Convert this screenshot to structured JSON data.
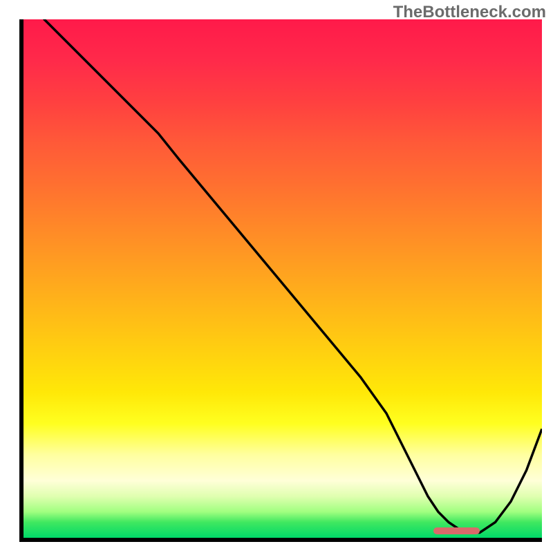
{
  "watermark": "TheBottleneck.com",
  "chart_data": {
    "type": "line",
    "title": "",
    "xlabel": "",
    "ylabel": "",
    "xlim": [
      0,
      100
    ],
    "ylim": [
      0,
      100
    ],
    "x": [
      0,
      4,
      22,
      26,
      30,
      35,
      40,
      45,
      50,
      55,
      60,
      65,
      70,
      72,
      74,
      76,
      78,
      80,
      82,
      85,
      88,
      91,
      94,
      97,
      100
    ],
    "values": [
      110,
      100,
      82,
      78,
      73,
      67,
      61,
      55,
      49,
      43,
      37,
      31,
      24,
      20,
      16,
      12,
      8,
      5,
      3,
      1,
      1,
      3,
      7,
      13,
      21
    ],
    "marker": {
      "x_start": 79,
      "x_end": 88,
      "y": 0.7
    },
    "gradient_colors": {
      "top": "#ff1a4a",
      "mid_upper": "#ff8828",
      "mid": "#ffe808",
      "mid_lower": "#ffffa0",
      "bottom": "#00d868"
    }
  }
}
